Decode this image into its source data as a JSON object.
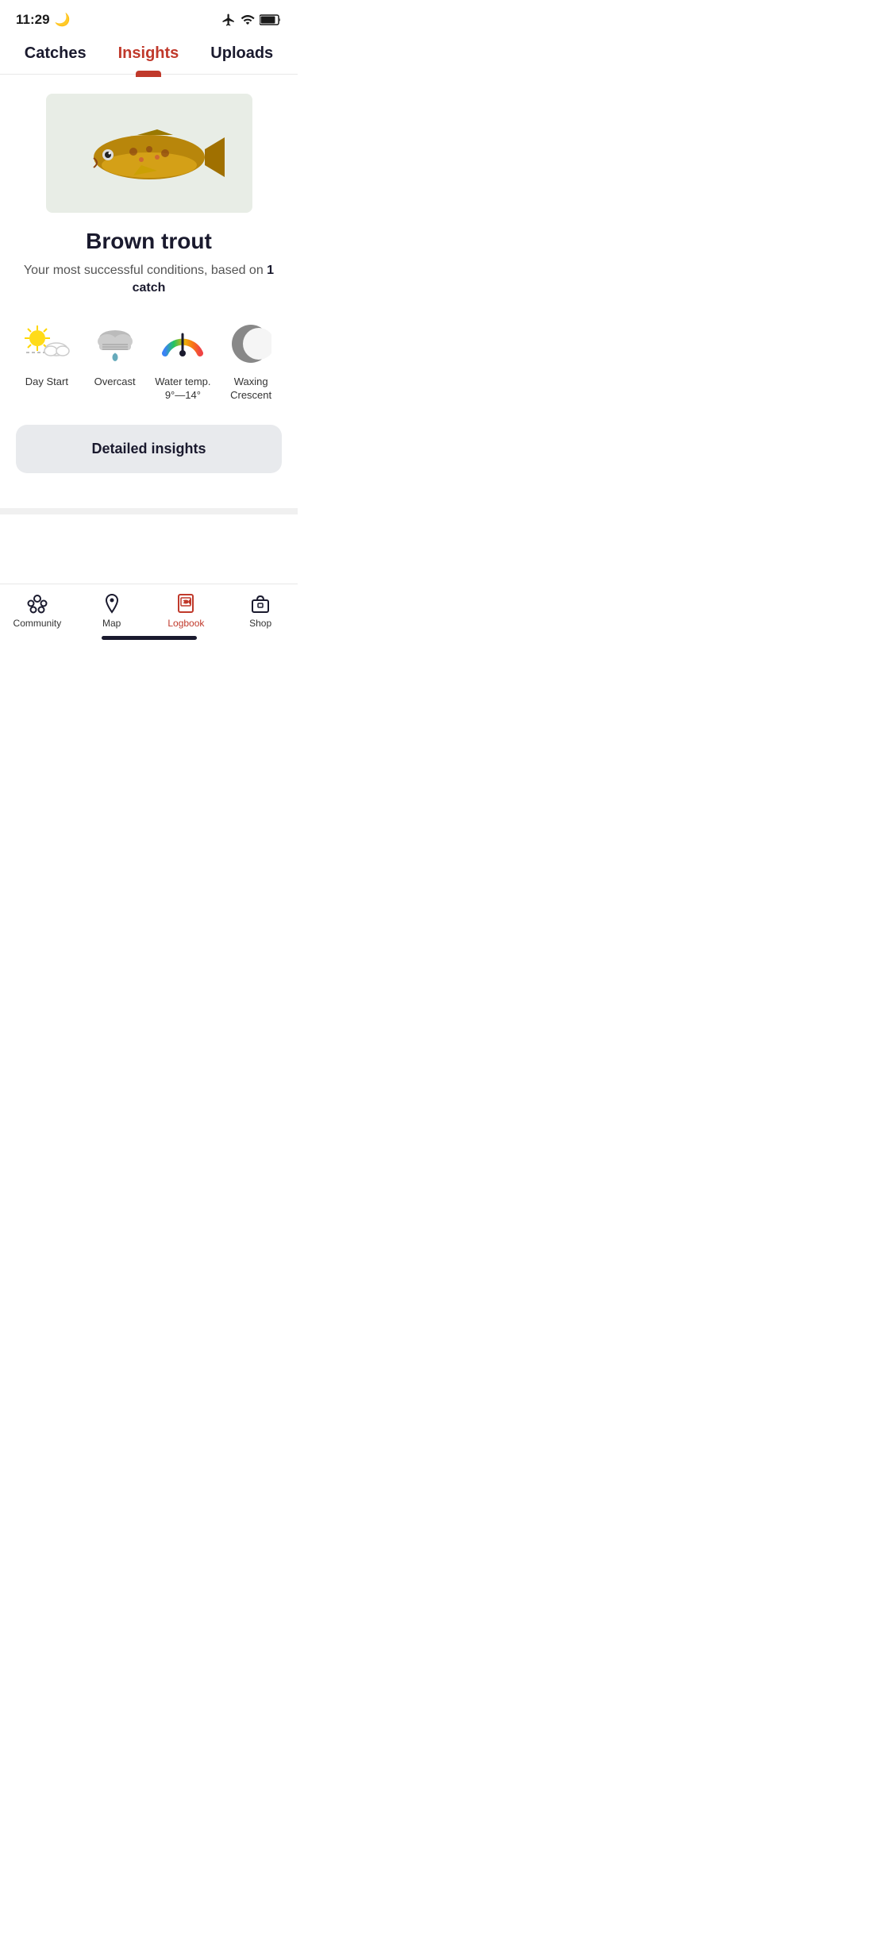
{
  "status": {
    "time": "11:29",
    "moon_icon": "🌙"
  },
  "top_tabs": [
    {
      "id": "catches",
      "label": "Catches",
      "active": false
    },
    {
      "id": "insights",
      "label": "Insights",
      "active": true
    },
    {
      "id": "uploads",
      "label": "Uploads",
      "active": false
    }
  ],
  "fish": {
    "name": "Brown trout",
    "subtitle_prefix": "Your most successful conditions, based on ",
    "catch_count": "1 catch"
  },
  "conditions": [
    {
      "id": "day-start",
      "label": "Day Start",
      "icon": "sun"
    },
    {
      "id": "overcast",
      "label": "Overcast",
      "icon": "cloud"
    },
    {
      "id": "water-temp",
      "label": "Water temp.\n9°—14°",
      "icon": "gauge"
    },
    {
      "id": "moon",
      "label": "Waxing Crescent",
      "icon": "moon"
    }
  ],
  "detailed_button": "Detailed insights",
  "bottom_nav": [
    {
      "id": "community",
      "label": "Community",
      "active": false,
      "icon": "community"
    },
    {
      "id": "map",
      "label": "Map",
      "active": false,
      "icon": "map"
    },
    {
      "id": "logbook",
      "label": "Logbook",
      "active": true,
      "icon": "logbook"
    },
    {
      "id": "shop",
      "label": "Shop",
      "active": false,
      "icon": "shop"
    }
  ]
}
